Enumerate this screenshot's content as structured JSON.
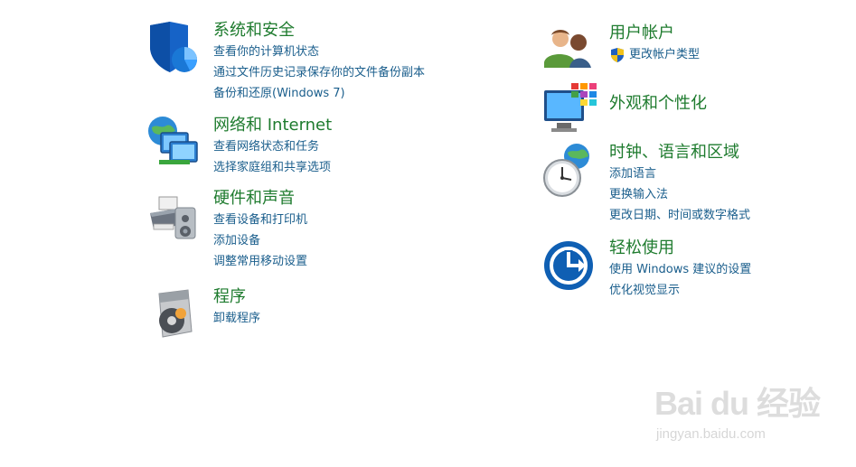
{
  "left": [
    {
      "title": "系统和安全",
      "links": [
        "查看你的计算机状态",
        "通过文件历史记录保存你的文件备份副本",
        "备份和还原(Windows 7)"
      ],
      "icon": "shield-security-icon"
    },
    {
      "title": "网络和 Internet",
      "links": [
        "查看网络状态和任务",
        "选择家庭组和共享选项"
      ],
      "icon": "network-globe-icon"
    },
    {
      "title": "硬件和声音",
      "links": [
        "查看设备和打印机",
        "添加设备",
        "调整常用移动设置"
      ],
      "icon": "printer-speaker-icon"
    },
    {
      "title": "程序",
      "links": [
        "卸载程序"
      ],
      "icon": "programs-disc-icon"
    }
  ],
  "right": [
    {
      "title": "用户帐户",
      "links": [
        "更改帐户类型"
      ],
      "icon": "users-icon"
    },
    {
      "title": "外观和个性化",
      "links": [],
      "icon": "appearance-monitor-icon"
    },
    {
      "title": "时钟、语言和区域",
      "links": [
        "添加语言",
        "更换输入法",
        "更改日期、时间或数字格式"
      ],
      "icon": "clock-globe-icon"
    },
    {
      "title": "轻松使用",
      "links": [
        "使用 Windows 建议的设置",
        "优化视觉显示"
      ],
      "icon": "ease-of-access-icon"
    }
  ],
  "watermark": {
    "brand": "Bai du 经验",
    "url": "jingyan.baidu.com"
  },
  "colors": {
    "title": "#1e7b2e",
    "link": "#1a5e8c"
  }
}
